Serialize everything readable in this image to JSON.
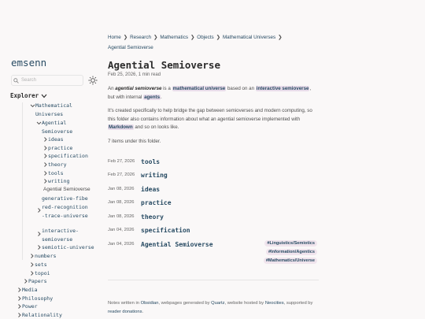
{
  "sidebar": {
    "site_title": "emsenn",
    "search_placeholder": "Search",
    "explorer_title": "Explorer",
    "tree": [
      {
        "label": "Mathematical Universes",
        "chevron": "open"
      },
      {
        "label": "Agential Semioverse",
        "chevron": "open"
      },
      {
        "label": "ideas",
        "chevron": "closed"
      },
      {
        "label": "practice",
        "chevron": "closed"
      },
      {
        "label": "specification",
        "chevron": "closed"
      },
      {
        "label": "theory",
        "chevron": "closed"
      },
      {
        "label": "tools",
        "chevron": "closed"
      },
      {
        "label": "writing",
        "chevron": "closed"
      },
      {
        "label": "Agential Semioverse",
        "chevron": "none"
      },
      {
        "label": "generative-fibered-recognition-trace-universe",
        "chevron": "closed"
      },
      {
        "label": "interactive-semioverse",
        "chevron": "closed"
      },
      {
        "label": "semiotic-universe",
        "chevron": "closed"
      },
      {
        "label": "numbers",
        "chevron": "closed"
      },
      {
        "label": "sets",
        "chevron": "closed"
      },
      {
        "label": "topoi",
        "chevron": "closed"
      },
      {
        "label": "Papers",
        "chevron": "closed"
      },
      {
        "label": "Media",
        "chevron": "closed"
      },
      {
        "label": "Philosophy",
        "chevron": "closed"
      },
      {
        "label": "Power",
        "chevron": "closed"
      },
      {
        "label": "Relationality",
        "chevron": "closed"
      }
    ]
  },
  "breadcrumb": {
    "items": [
      "Home",
      "Research",
      "Mathematics",
      "Objects",
      "Mathematical Universes"
    ],
    "current": "Agential Semioverse"
  },
  "page": {
    "title": "Agential Semioverse",
    "meta": "Feb 25, 2026, 1 min read",
    "p1": {
      "t1": "An ",
      "em": "agential semioverse",
      "t2": " is a ",
      "link1": "mathematical universe",
      "t3": " based on an ",
      "link2": "interactive semioverse",
      "t4": ", but with internal ",
      "link3": "agents",
      "t5": "."
    },
    "p2": {
      "t1": "It's created specifically to help bridge the gap between semioverses and modern computing, so this folder also contains information about what an agential semioverse implemented with ",
      "link1": "Markdown",
      "t2": " and so on looks like."
    },
    "items_count": "7 items under this folder.",
    "items": [
      {
        "date": "Feb 27, 2026",
        "title": "tools"
      },
      {
        "date": "Feb 27, 2026",
        "title": "writing"
      },
      {
        "date": "Jan 08, 2026",
        "title": "ideas"
      },
      {
        "date": "Jan 08, 2026",
        "title": "practice"
      },
      {
        "date": "Jan 08, 2026",
        "title": "theory"
      },
      {
        "date": "Jan 04, 2026",
        "title": "specification"
      },
      {
        "date": "Jan 04, 2026",
        "title": "Agential Semioverse"
      }
    ],
    "tags": [
      "#Linguistics/Semiotics",
      "#Information/Agentics",
      "#Mathematics/Universe"
    ]
  },
  "footer": {
    "t1": "Notes written in ",
    "l1": "Obsidian",
    "t2": ", webpages generated by ",
    "l2": "Quartz",
    "t3": ", website hosted by ",
    "l3": "Neocities",
    "t4": ", supported by ",
    "l4": "reader donations",
    "t5": "."
  },
  "colors": {
    "accent": "#284b63",
    "highlight": "#e8dcea",
    "text": "#4e4e4e",
    "muted": "#646464",
    "background": "#faf8f8"
  }
}
